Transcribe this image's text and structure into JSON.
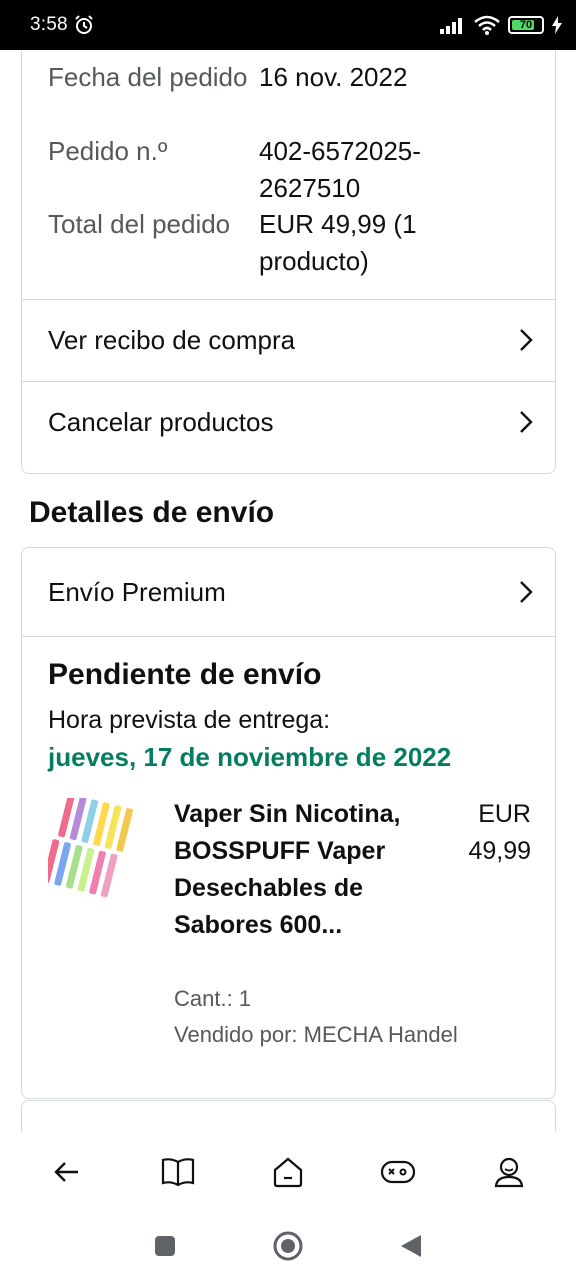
{
  "status_bar": {
    "time": "3:58",
    "battery": "70",
    "icons": [
      "alarm-icon",
      "signal-icon",
      "wifi-icon",
      "battery-icon",
      "charging-icon"
    ]
  },
  "order_summary": {
    "date_label": "Fecha del pedido",
    "date_value": "16 nov. 2022",
    "number_label": "Pedido n.º",
    "number_value": "402-6572025-2627510",
    "total_label": "Total del pedido",
    "total_value": "EUR 49,99 (1 producto)"
  },
  "links": {
    "receipt": "Ver recibo de compra",
    "cancel": "Cancelar productos"
  },
  "shipping": {
    "section_title": "Detalles de envío",
    "method": "Envío Premium",
    "status": "Pendiente de envío",
    "eta_label": "Hora prevista de entrega:",
    "eta_date": "jueves, 17 de noviembre de 2022"
  },
  "product": {
    "name": "Vaper Sin Nicotina, BOSSPUFF Vaper Desechables de Sabores 600...",
    "price": "EUR 49,99",
    "quantity": "Cant.: 1",
    "seller": "Vendido por: MECHA Handel"
  },
  "partial_row": "",
  "bottom_nav": [
    "back-icon",
    "book-icon",
    "home-icon",
    "gamepad-icon",
    "profile-icon"
  ],
  "colors": {
    "accent_green": "#067d62",
    "border": "#d5d9d9",
    "secondary_text": "#565959"
  }
}
